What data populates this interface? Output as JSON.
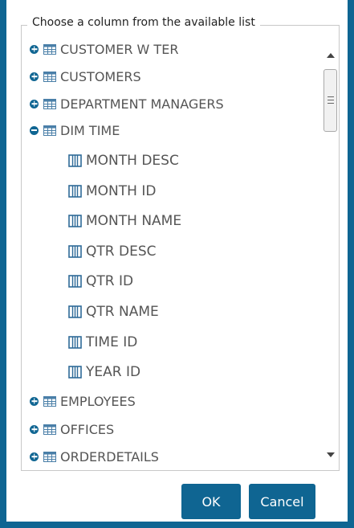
{
  "panel": {
    "legend": "Choose a column from the available list"
  },
  "tree": {
    "items": [
      {
        "label": "CUSTOMER W TER",
        "kind": "table",
        "expanded": false
      },
      {
        "label": "CUSTOMERS",
        "kind": "table",
        "expanded": false
      },
      {
        "label": "DEPARTMENT MANAGERS",
        "kind": "table",
        "expanded": false
      },
      {
        "label": "DIM TIME",
        "kind": "table",
        "expanded": true
      },
      {
        "label": "MONTH DESC",
        "kind": "column"
      },
      {
        "label": "MONTH ID",
        "kind": "column"
      },
      {
        "label": "MONTH NAME",
        "kind": "column"
      },
      {
        "label": "QTR DESC",
        "kind": "column"
      },
      {
        "label": "QTR ID",
        "kind": "column"
      },
      {
        "label": "QTR NAME",
        "kind": "column"
      },
      {
        "label": "TIME ID",
        "kind": "column"
      },
      {
        "label": "YEAR ID",
        "kind": "column"
      },
      {
        "label": "EMPLOYEES",
        "kind": "table",
        "expanded": false
      },
      {
        "label": "OFFICES",
        "kind": "table",
        "expanded": false
      },
      {
        "label": "ORDERDETAILS",
        "kind": "table",
        "expanded": false
      }
    ]
  },
  "buttons": {
    "ok": "OK",
    "cancel": "Cancel"
  },
  "colors": {
    "accent": "#0f6592",
    "text": "#555555"
  }
}
